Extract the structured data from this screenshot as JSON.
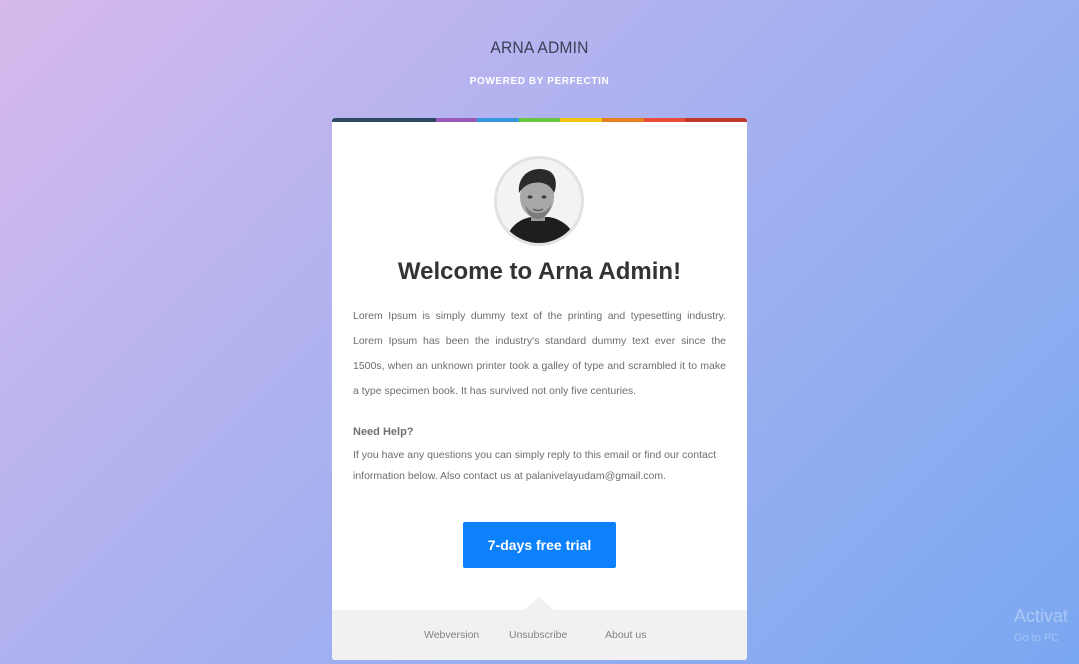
{
  "header": {
    "title": "ARNA ADMIN",
    "subtitle": "POWERED BY PERFECTIN"
  },
  "colors": {
    "strip": [
      "#2c4862",
      "#9b59b6",
      "#3498db",
      "#6cc644",
      "#f1c40f",
      "#e67e22",
      "#e74c3c",
      "#c0392b"
    ],
    "button": "#0d80fb"
  },
  "card": {
    "avatar_alt": "profile photo",
    "welcome": "Welcome to Arna Admin!",
    "intro": "Lorem Ipsum is simply dummy text of the printing and typesetting industry. Lorem Ipsum has been the industry's standard dummy text ever since the 1500s, when an unknown printer took a galley of type and scrambled it to make a type specimen book. It has survived not only five centuries.",
    "help_title": "Need Help?",
    "help_text": "If you have any questions you can simply reply to this email or find our contact information below. Also contact us at palanivelayudam@gmail.com.",
    "cta_label": "7-days free trial"
  },
  "footer": {
    "links": [
      "Webversion",
      "Unsubscribe",
      "About us"
    ]
  },
  "watermark": {
    "line1": "Activat",
    "line2": "Go to PC"
  }
}
